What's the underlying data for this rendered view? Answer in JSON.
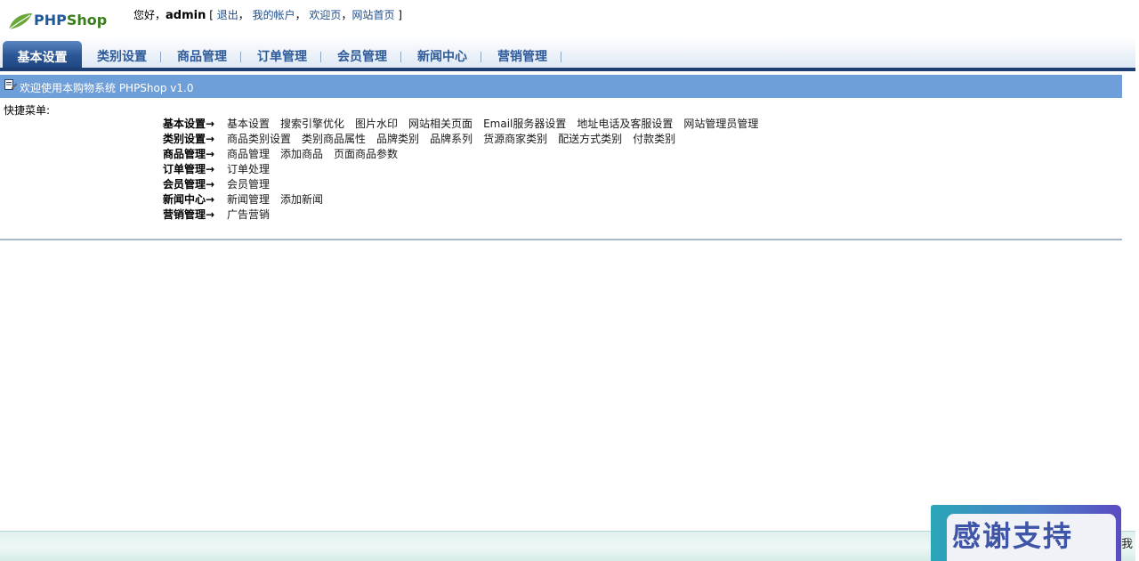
{
  "header": {
    "logo": {
      "php": "PHP",
      "shop": "Shop"
    },
    "greeting": "您好，",
    "username": "admin",
    "links": [
      {
        "label": "退出"
      },
      {
        "label": "我的帐户"
      },
      {
        "label": "欢迎页"
      },
      {
        "label": "网站首页"
      }
    ]
  },
  "nav": {
    "tabs": [
      {
        "label": "基本设置"
      },
      {
        "label": "类别设置"
      },
      {
        "label": "商品管理"
      },
      {
        "label": "订单管理"
      },
      {
        "label": "会员管理"
      },
      {
        "label": "新闻中心"
      },
      {
        "label": "营销管理"
      }
    ]
  },
  "welcome": {
    "text": "欢迎使用本购物系统 PHPShop v1.0"
  },
  "quick_menu": {
    "label": "快捷菜单:",
    "rows": [
      {
        "title": "基本设置→",
        "links": [
          "基本设置",
          "搜索引擎优化",
          "图片水印",
          "网站相关页面",
          "Email服务器设置",
          "地址电话及客服设置",
          "网站管理员管理"
        ]
      },
      {
        "title": "类别设置→",
        "links": [
          "商品类别设置",
          "类别商品属性",
          "品牌类别",
          "品牌系列",
          "货源商家类别",
          "配送方式类别",
          "付款类别"
        ]
      },
      {
        "title": "商品管理→",
        "links": [
          "商品管理",
          "添加商品",
          "页面商品参数"
        ]
      },
      {
        "title": "订单管理→",
        "links": [
          "订单处理"
        ]
      },
      {
        "title": "会员管理→",
        "links": [
          "会员管理"
        ]
      },
      {
        "title": "新闻中心→",
        "links": [
          "新闻管理",
          "添加新闻"
        ]
      },
      {
        "title": "营销管理→",
        "links": [
          "广告营销"
        ]
      }
    ]
  },
  "footer": {
    "thanks": "感谢支持",
    "edge": "我"
  },
  "colors": {
    "nav_active": "#2c5796",
    "welcome_bar": "#6f9fd8",
    "link": "#1a4b8c"
  }
}
